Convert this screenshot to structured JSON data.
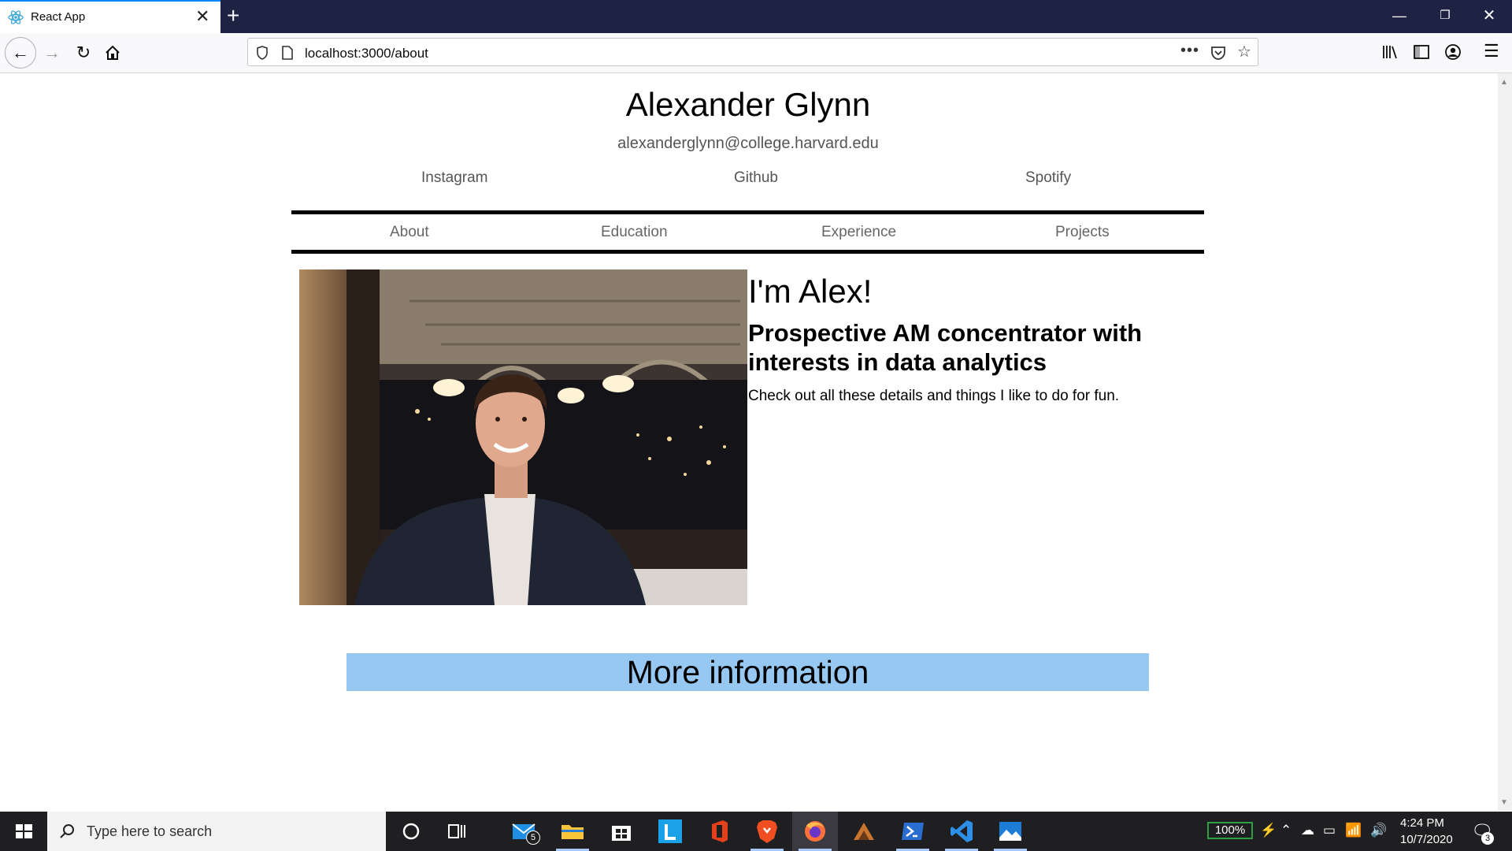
{
  "browser": {
    "tab_title": "React App",
    "url": "localhost:3000/about",
    "new_tab": "+",
    "close_tab": "✕"
  },
  "page": {
    "name": "Alexander Glynn",
    "email": "alexanderglynn@college.harvard.edu",
    "social_links": [
      "Instagram",
      "Github",
      "Spotify"
    ],
    "menu": [
      "About",
      "Education",
      "Experience",
      "Projects"
    ],
    "heading": "I'm Alex!",
    "subheading": "Prospective AM concentrator with interests in data analytics",
    "paragraph": "Check out all these details and things I like to do for fun.",
    "more_info": "More information"
  },
  "taskbar": {
    "search_placeholder": "Type here to search",
    "mail_badge": "5",
    "battery": "100%",
    "time": "4:24 PM",
    "date": "10/7/2020",
    "notification_count": "3"
  },
  "colors": {
    "tabbar": "#1e2344",
    "accent_tab": "#0a84ff",
    "more_info_bg": "#96c8f2",
    "taskbar": "#1f1f22"
  }
}
